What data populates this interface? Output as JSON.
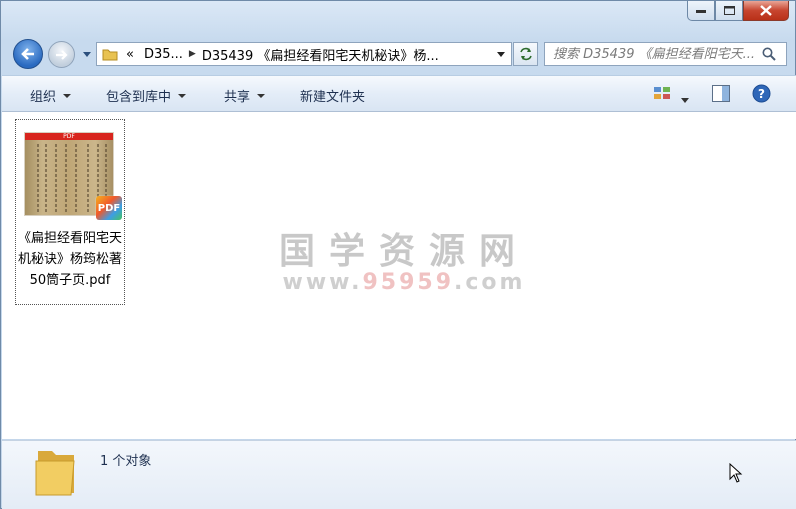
{
  "address_bar": {
    "crumbs": [
      "D35...",
      "D35439 《扁担经看阳宅天机秘诀》杨..."
    ],
    "overflow_glyph": "«"
  },
  "search": {
    "placeholder": "搜索 D35439 《扁担经看阳宅天..."
  },
  "toolbar": {
    "organize": "组织",
    "include_library": "包含到库中",
    "share": "共享",
    "new_folder": "新建文件夹"
  },
  "file": {
    "name": "《扁担经看阳宅天机秘诀》杨筠松著 50筒子页.pdf",
    "badge": "PDF",
    "thumb_header": "PDF"
  },
  "watermark": {
    "line1": "国学资源网",
    "line2_prefix": "www.",
    "line2_highlight": "95959",
    "line2_suffix": ".com"
  },
  "status": {
    "count_text": "1 个对象"
  },
  "colors": {
    "accent": "#2a6ac0",
    "close": "#c7452f"
  }
}
